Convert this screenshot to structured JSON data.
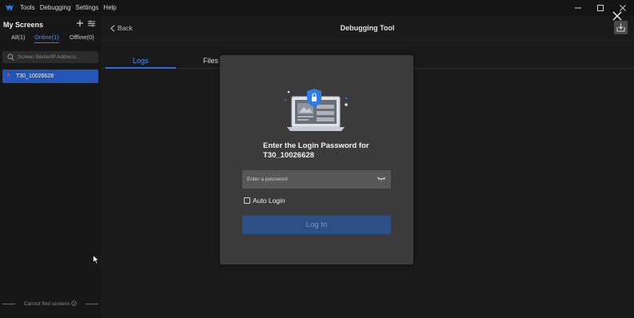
{
  "menu": [
    "Tools",
    "Debugging",
    "Settings",
    "Help"
  ],
  "sidebar": {
    "title": "My Screens",
    "tabs": [
      {
        "label": "All(1)",
        "active": false
      },
      {
        "label": "Online(1)",
        "active": true
      },
      {
        "label": "Offline(0)",
        "active": false
      }
    ],
    "search_placeholder": "Screen Name/IP Address...",
    "items": [
      {
        "label": "T30_10026628",
        "status": "offline-red"
      }
    ],
    "footer": "Cannot find screens"
  },
  "header": {
    "back_label": "Back",
    "title": "Debugging Tool"
  },
  "tabs": [
    "Logs",
    "Files"
  ],
  "dialog": {
    "title_line1": "Enter the Login Password for",
    "title_line2": "T30_10026628",
    "password_placeholder": "Enter a password",
    "auto_login_label": "Auto Login",
    "auto_login_checked": false,
    "login_button": "Log In"
  },
  "colors": {
    "accent": "#2f6bd8",
    "selected_item": "#2355b8",
    "dialog_bg": "#3b3b3b",
    "login_button": "#2d4f88"
  }
}
